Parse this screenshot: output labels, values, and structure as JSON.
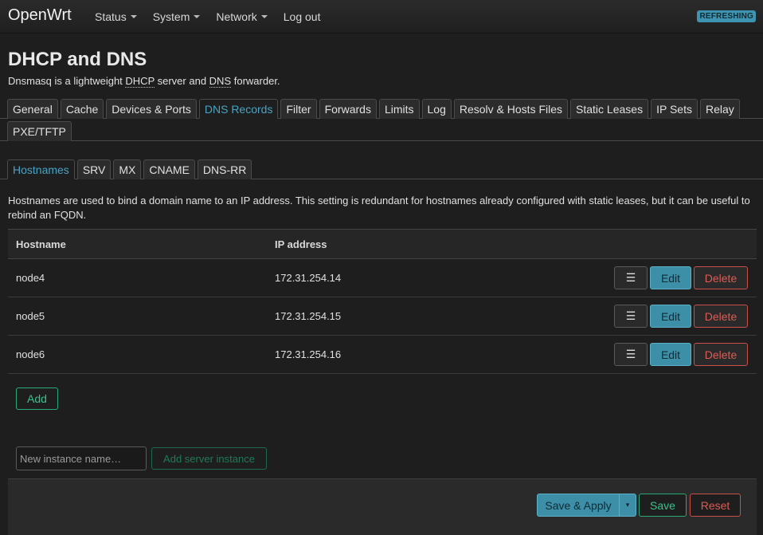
{
  "header": {
    "brand": "OpenWrt",
    "menu": [
      {
        "label": "Status",
        "dropdown": true
      },
      {
        "label": "System",
        "dropdown": true
      },
      {
        "label": "Network",
        "dropdown": true
      },
      {
        "label": "Log out",
        "dropdown": false
      }
    ],
    "badge": "REFRESHING"
  },
  "page": {
    "title": "DHCP and DNS",
    "desc_pre": "Dnsmasq is a lightweight ",
    "desc_abbr1": "DHCP",
    "desc_mid": " server and ",
    "desc_abbr2": "DNS",
    "desc_post": " forwarder."
  },
  "main_tabs": {
    "row1": [
      "General",
      "Cache",
      "Devices & Ports",
      "DNS Records",
      "Filter",
      "Forwards",
      "Limits",
      "Log",
      "Resolv & Hosts Files",
      "Static Leases",
      "IP Sets",
      "Relay"
    ],
    "row2": [
      "PXE/TFTP"
    ],
    "active": "DNS Records"
  },
  "sub_tabs": {
    "items": [
      "Hostnames",
      "SRV",
      "MX",
      "CNAME",
      "DNS-RR"
    ],
    "active": "Hostnames"
  },
  "help_text": "Hostnames are used to bind a domain name to an IP address. This setting is redundant for hostnames already configured with static leases, but it can be useful to rebind an FQDN.",
  "table": {
    "columns": [
      "Hostname",
      "IP address"
    ],
    "rows": [
      {
        "hostname": "node4",
        "ip": "172.31.254.14"
      },
      {
        "hostname": "node5",
        "ip": "172.31.254.15"
      },
      {
        "hostname": "node6",
        "ip": "172.31.254.16"
      }
    ],
    "drag_label": "☰",
    "edit_label": "Edit",
    "delete_label": "Delete",
    "add_label": "Add"
  },
  "instance": {
    "placeholder": "New instance name…",
    "add_label": "Add server instance"
  },
  "footer": {
    "save_apply": "Save & Apply",
    "caret": "▾",
    "save": "Save",
    "reset": "Reset"
  },
  "colors": {
    "accent": "#48a3c4",
    "positive": "#36c48c",
    "negative": "#e05a52"
  }
}
